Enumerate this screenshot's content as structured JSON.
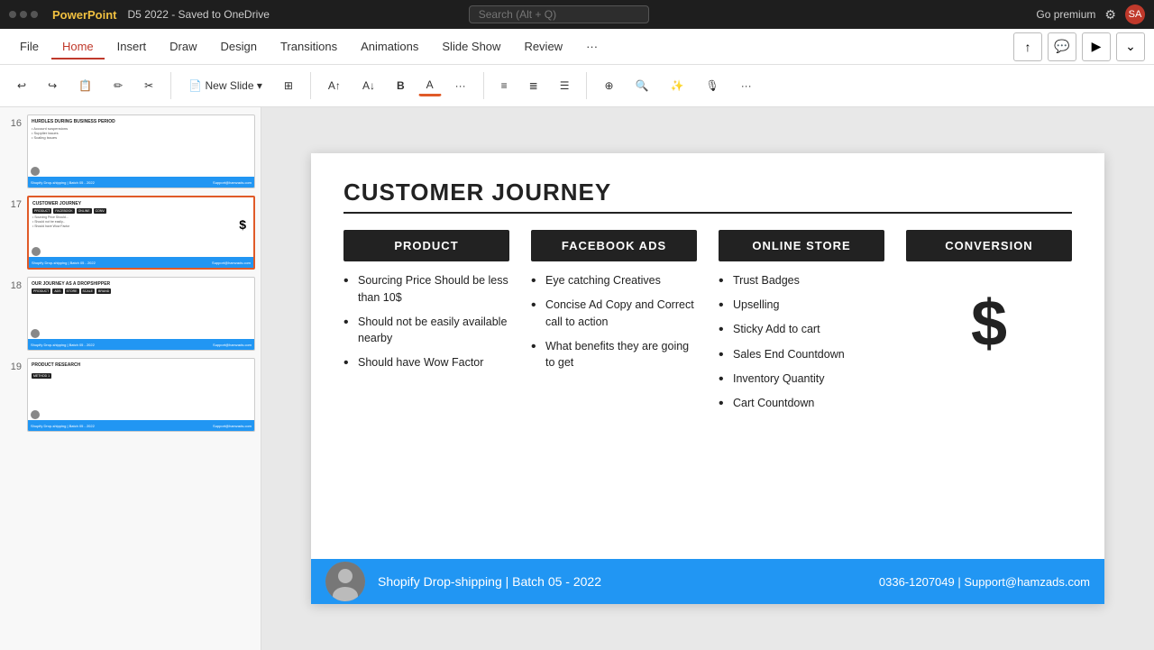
{
  "titleBar": {
    "appName": "PowerPoint",
    "fileName": "D5 2022 - Saved to OneDrive",
    "searchPlaceholder": "Search (Alt + Q)",
    "rightActions": [
      "Go premium",
      "settings",
      "account"
    ]
  },
  "ribbon": {
    "tabs": [
      "File",
      "Home",
      "Insert",
      "Draw",
      "Design",
      "Transitions",
      "Animations",
      "Slide Show",
      "Review"
    ],
    "activeTab": "Home",
    "tools": {
      "newSlide": "New Slide",
      "fontSizeUp": "A↑",
      "fontSizeDown": "A↓",
      "bold": "B"
    }
  },
  "slidePanel": {
    "slides": [
      {
        "num": "16",
        "label": "HURDLES DURING BUSINESS PERIOD",
        "hasBlue": true
      },
      {
        "num": "17",
        "label": "CUSTOMER JOURNEY",
        "hasBlue": true,
        "active": true
      },
      {
        "num": "18",
        "label": "OUR JOURNEY AS A DROPSHIPPER",
        "hasBlue": true
      },
      {
        "num": "19",
        "label": "PRODUCT RESEARCH",
        "hasBlue": true
      }
    ]
  },
  "slide": {
    "title": "CUSTOMER JOURNEY",
    "columns": [
      {
        "header": "PRODUCT",
        "bullets": [
          "Sourcing Price Should be less than 10$",
          "Should not be easily available nearby",
          "Should have Wow Factor"
        ],
        "isDollar": false
      },
      {
        "header": "FACEBOOK ADS",
        "bullets": [
          "Eye catching Creatives",
          "Concise Ad Copy and Correct call to action",
          "What benefits they are going to get"
        ],
        "isDollar": false
      },
      {
        "header": "ONLINE STORE",
        "bullets": [
          "Trust Badges",
          "Upselling",
          "Sticky Add to cart",
          "Sales End Countdown",
          "Inventory Quantity",
          "Cart Countdown"
        ],
        "isDollar": false
      },
      {
        "header": "CONVERSION",
        "bullets": [],
        "isDollar": true,
        "dollarSymbol": "$"
      }
    ],
    "footer": {
      "avatarIcon": "👤",
      "text": "Shopify Drop-shipping | Batch 05 - 2022",
      "contact": "0336-1207049  |  Support@hamzads.com"
    }
  }
}
